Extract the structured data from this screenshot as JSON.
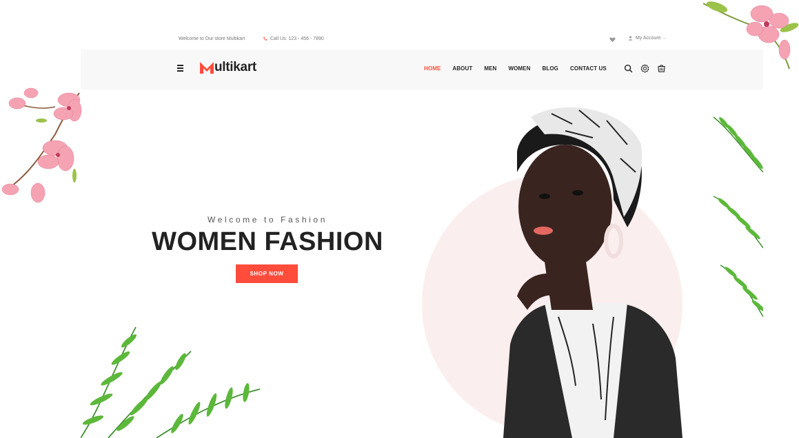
{
  "topbar": {
    "welcome_text": "Welcome to Our store Multikart",
    "call_text": "Call Us:  123 - 456 - 7890",
    "account_text": "My Account"
  },
  "header": {
    "logo_text": "ultikart",
    "nav": [
      {
        "label": "HOME",
        "active": true
      },
      {
        "label": "ABOUT",
        "active": false
      },
      {
        "label": "MEN",
        "active": false
      },
      {
        "label": "WOMEN",
        "active": false
      },
      {
        "label": "BLOG",
        "active": false
      },
      {
        "label": "CONTACT US",
        "active": false
      }
    ],
    "icons": [
      "search-icon",
      "settings-icon",
      "cart-icon"
    ]
  },
  "hero": {
    "subtitle": "Welcome to Fashion",
    "title": "WOMEN FASHION",
    "button_label": "SHOP NOW"
  },
  "colors": {
    "accent": "#ff4c3b",
    "header_bg": "#f8f8f8",
    "circle": "#fbeeee",
    "leaf_green": "#4caf50",
    "flower_pink": "#f28aa0"
  }
}
